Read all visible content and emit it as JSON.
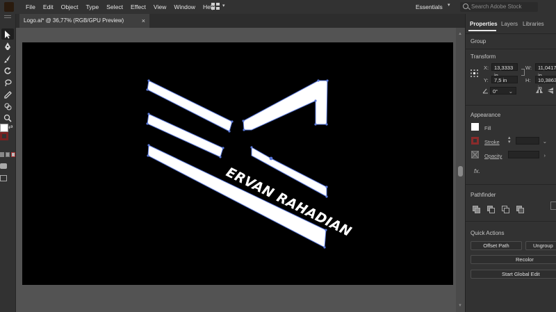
{
  "menubar": {
    "logo_icon": "illustrator-logo-icon",
    "items": [
      "File",
      "Edit",
      "Object",
      "Type",
      "Select",
      "Effect",
      "View",
      "Window",
      "Help"
    ],
    "workspace": "Essentials",
    "search_placeholder": "Search Adobe Stock"
  },
  "document_tab": {
    "title": "Logo.ai* @ 36,77% (RGB/GPU Preview)",
    "close": "×"
  },
  "artwork": {
    "text": "ERVAN RAHADIAN",
    "background_color": "#000000",
    "shape_color": "#ffffff",
    "selection_color": "#5a78d8"
  },
  "panel": {
    "tabs": [
      "Properties",
      "Layers",
      "Libraries"
    ],
    "selection_type": "Group",
    "transform": {
      "title": "Transform",
      "x_label": "X:",
      "x_value": "13,3333 in",
      "y_label": "Y:",
      "y_value": "7,5 in",
      "w_label": "W:",
      "w_value": "11,0417 in",
      "h_label": "H:",
      "h_value": "10,3863 in",
      "angle_value": "0°"
    },
    "appearance": {
      "title": "Appearance",
      "fill_label": "Fill",
      "stroke_label": "Stroke",
      "opacity_label": "Opacity",
      "fx_label": "fx."
    },
    "pathfinder": {
      "title": "Pathfinder"
    },
    "quick_actions": {
      "title": "Quick Actions",
      "offset_path": "Offset Path",
      "ungroup": "Ungroup",
      "recolor": "Recolor",
      "start_global_edit": "Start Global Edit"
    }
  }
}
